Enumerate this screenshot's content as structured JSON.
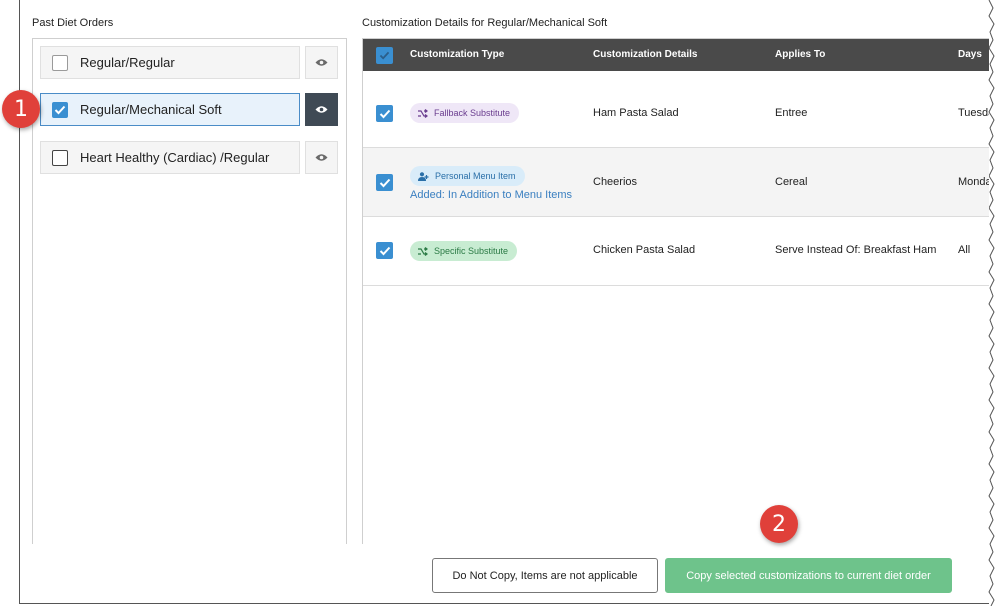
{
  "left": {
    "title": "Past Diet Orders",
    "items": [
      {
        "label": "Regular/Regular",
        "checked": false
      },
      {
        "label": "Regular/Mechanical Soft",
        "checked": true
      },
      {
        "label": "Heart Healthy (Cardiac) /Regular",
        "checked": false
      }
    ]
  },
  "right": {
    "title": "Customization Details for Regular/Mechanical Soft",
    "columns": {
      "type": "Customization Type",
      "details": "Customization Details",
      "applies": "Applies To",
      "days": "Days"
    },
    "rows": [
      {
        "type": "Fallback Substitute",
        "type_icon": "shuffle-icon",
        "details": "Ham Pasta Salad",
        "applies": "Entree",
        "days": "Tuesday"
      },
      {
        "type": "Personal Menu Item",
        "type_icon": "person-icon",
        "sub": "Added: In Addition to Menu Items",
        "details": "Cheerios",
        "applies": "Cereal",
        "days": "Monday"
      },
      {
        "type": "Specific Substitute",
        "type_icon": "shuffle-icon",
        "details": "Chicken Pasta Salad",
        "applies": "Serve Instead Of: Breakfast Ham",
        "days": "All"
      }
    ]
  },
  "markers": [
    "1",
    "2"
  ],
  "buttons": {
    "no_copy": "Do Not Copy, Items are not applicable",
    "copy": "Copy selected customizations to current diet order"
  },
  "colors": {
    "accent": "#3a8fd1",
    "header": "#4a4a4a",
    "copy_button": "#6ec38b",
    "marker": "#e0403a",
    "selected_row": "#e8f2fb"
  }
}
